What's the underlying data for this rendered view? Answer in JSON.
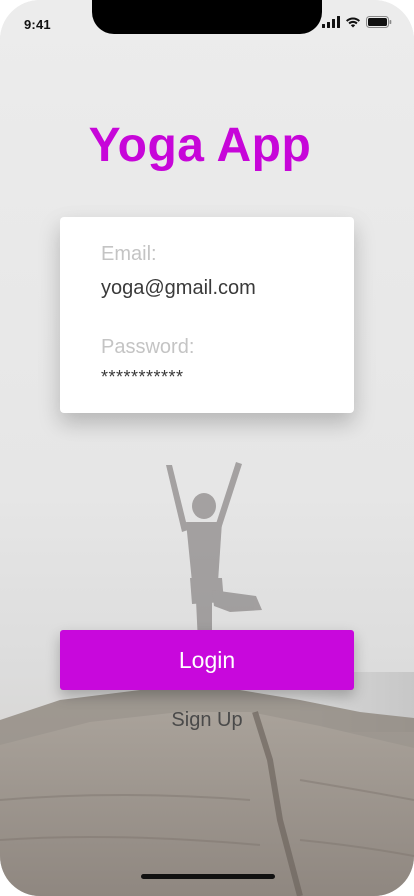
{
  "status_bar": {
    "time": "9:41",
    "icons": [
      "cellular-signal-icon",
      "wifi-icon",
      "battery-icon"
    ]
  },
  "app": {
    "title": "Yoga App"
  },
  "login_form": {
    "email_label": "Email:",
    "email_value": "yoga@gmail.com",
    "password_label": "Password:",
    "password_value": "***********"
  },
  "actions": {
    "login_label": "Login",
    "signup_label": "Sign Up"
  },
  "colors": {
    "accent": "#c706d9",
    "button": "#c808dc",
    "label": "#c4c4c4",
    "value_text": "#3a3a3a"
  }
}
